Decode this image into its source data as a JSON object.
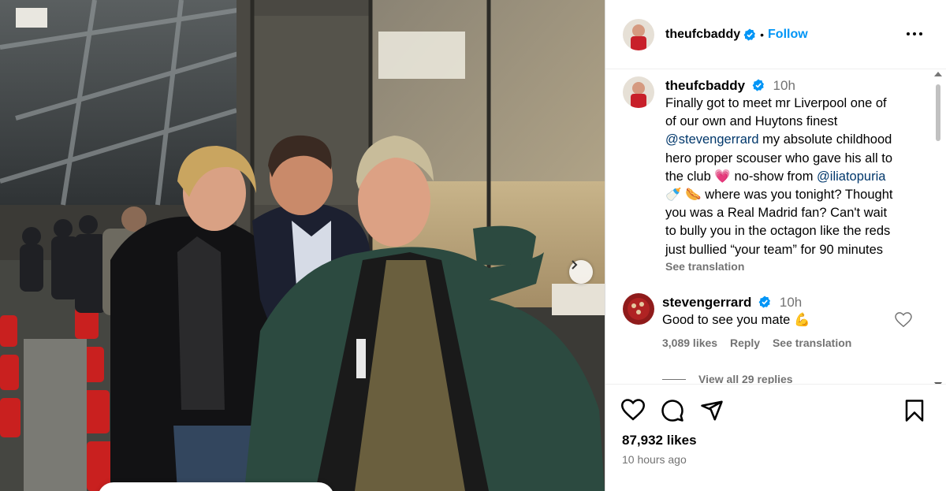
{
  "post": {
    "username": "theufcbaddy",
    "follow_label": "Follow",
    "dot": "•",
    "caption": {
      "username": "theufcbaddy",
      "time": "10h",
      "lines": [
        "Finally got to meet mr Liverpool one of",
        "of our own and Huytons finest"
      ],
      "mention1": "@stevengerrard",
      "line3_rest": " my absolute childhood",
      "line4": "hero proper scouser who gave his all to",
      "line5_a": "the club ",
      "emoji_heart": "💗",
      "line5_b": " no-show from ",
      "mention2": "@iliatopuria",
      "emoji_baby_bottle": "🍼",
      "emoji_hotdog": "🌭",
      "line6_rest": " where was you tonight? Thought",
      "line7": "you was a Real Madrid fan? Can't wait",
      "line8": "to bully you in the octagon like the reds",
      "line9": "just bullied “your team” for 90 minutes",
      "see_translation": "See translation"
    },
    "comment": {
      "username": "stevengerrard",
      "time": "10h",
      "text": "Good to see you mate ",
      "emoji": "💪",
      "likes": "3,089 likes",
      "reply": "Reply",
      "see_translation": "See translation"
    },
    "view_replies": "View all 29 replies",
    "likes": "87,932 likes",
    "time_ago": "10 hours ago"
  },
  "colors": {
    "accent": "#0095f6",
    "verified": "#0095f6",
    "mention": "#00376b",
    "muted": "#737373"
  },
  "icons": [
    "more-icon",
    "heart-icon",
    "comment-icon",
    "share-icon",
    "save-icon",
    "verified-icon",
    "next-arrow-icon"
  ]
}
